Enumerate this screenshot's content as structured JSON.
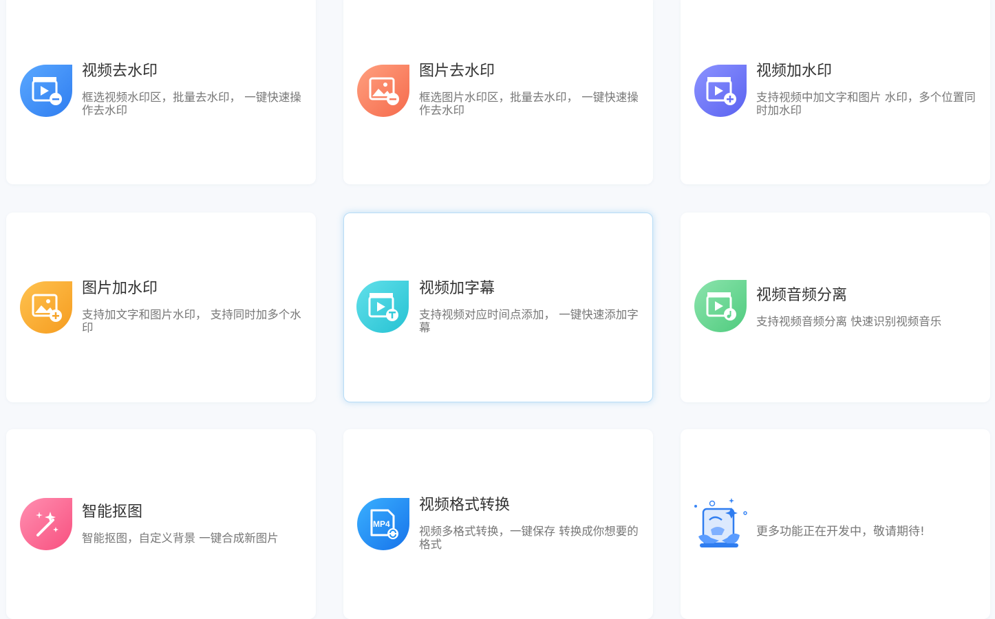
{
  "cards": [
    {
      "title": "视频去水印",
      "desc": "框选视频水印区，批量去水印， 一键快速操作去水印",
      "icon": "video-remove-watermark-icon",
      "color": "#3a86f5"
    },
    {
      "title": "图片去水印",
      "desc": "框选图片水印区，批量去水印， 一键快速操作去水印",
      "icon": "image-remove-watermark-icon",
      "color": "#f7795c"
    },
    {
      "title": "视频加水印",
      "desc": "支持视频中加文字和图片 水印，多个位置同时加水印",
      "icon": "video-add-watermark-icon",
      "color": "#6670f5"
    },
    {
      "title": "图片加水印",
      "desc": "支持加文字和图片水印， 支持同时加多个水印",
      "icon": "image-add-watermark-icon",
      "color": "#f7a52c"
    },
    {
      "title": "视频加字幕",
      "desc": "支持视频对应时间点添加， 一键快速添加字幕",
      "icon": "video-subtitle-icon",
      "color": "#34cbd9"
    },
    {
      "title": "视频音频分离",
      "desc": "支持视频音频分离 快速识别视频音乐",
      "icon": "video-audio-split-icon",
      "color": "#5fd38c"
    },
    {
      "title": "智能抠图",
      "desc": "智能抠图，自定义背景 一键合成新图片",
      "icon": "smart-cutout-icon",
      "color": "#fb5f8e"
    },
    {
      "title": "视频格式转换",
      "desc": "视频多格式转换，一键保存 转换成你想要的格式",
      "icon": "video-format-convert-icon",
      "color": "#1b8ff5",
      "badge": "MP4"
    }
  ],
  "more": {
    "text": "更多功能正在开发中，敬请期待!",
    "icon": "coming-soon-illustration-icon"
  }
}
